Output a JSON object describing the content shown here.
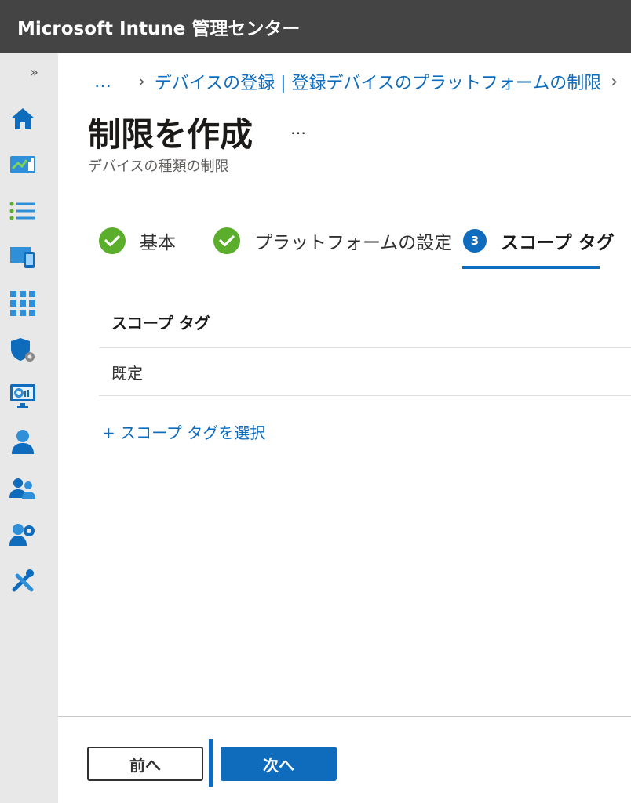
{
  "app": {
    "title": "Microsoft Intune 管理センター"
  },
  "sidebar": {
    "collapse_glyph": "»",
    "items": [
      {
        "icon": "home-icon"
      },
      {
        "icon": "dashboard-icon"
      },
      {
        "icon": "all-services-icon"
      },
      {
        "icon": "devices-icon"
      },
      {
        "icon": "apps-icon"
      },
      {
        "icon": "endpoint-security-icon"
      },
      {
        "icon": "reports-icon"
      },
      {
        "icon": "users-icon"
      },
      {
        "icon": "groups-icon"
      },
      {
        "icon": "tenant-admin-icon"
      },
      {
        "icon": "troubleshooting-icon"
      }
    ]
  },
  "breadcrumb": {
    "ellipsis": "…",
    "item": "デバイスの登録 | 登録デバイスのプラットフォームの制限"
  },
  "page": {
    "title": "制限を作成",
    "more": "…",
    "subtitle": "デバイスの種類の制限"
  },
  "wizard": {
    "steps": [
      {
        "label": "基本",
        "state": "complete"
      },
      {
        "label": "プラットフォームの設定",
        "state": "complete"
      },
      {
        "number": "3",
        "label": "スコープ タグ",
        "state": "active"
      }
    ]
  },
  "scope_table": {
    "header": "スコープ タグ",
    "rows": [
      "既定"
    ],
    "add_link": "+ スコープ タグを選択"
  },
  "footer": {
    "prev_label": "前へ",
    "next_label": "次へ"
  },
  "colors": {
    "topbar": "#444444",
    "accent": "#0f6cbd",
    "success": "#5bae2b",
    "sidebar": "#e8e8e8"
  }
}
